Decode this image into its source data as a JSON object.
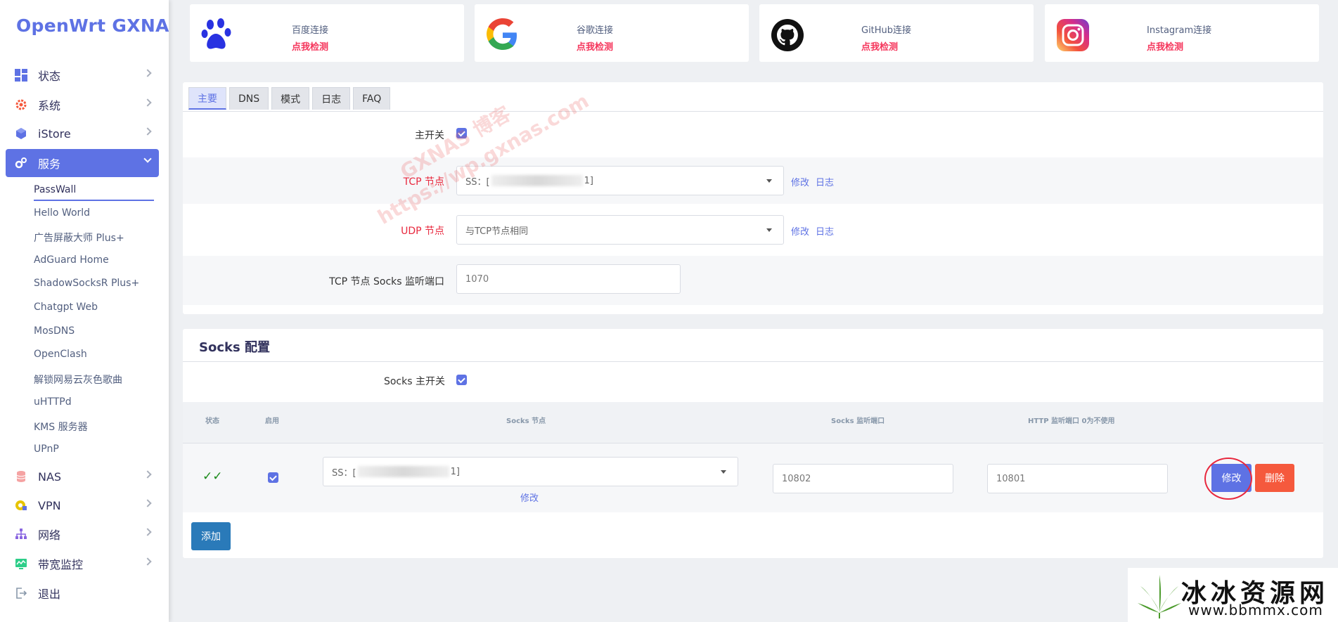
{
  "brand": "OpenWrt GXNAS",
  "sidebar": {
    "items": [
      {
        "label": "状态"
      },
      {
        "label": "系统"
      },
      {
        "label": "iStore"
      },
      {
        "label": "服务"
      },
      {
        "label": "NAS"
      },
      {
        "label": "VPN"
      },
      {
        "label": "网络"
      },
      {
        "label": "带宽监控"
      },
      {
        "label": "退出"
      }
    ],
    "sub_items": [
      "PassWall",
      "Hello World",
      "广告屏蔽大师 Plus+",
      "AdGuard Home",
      "ShadowSocksR Plus+",
      "Chatgpt Web",
      "MosDNS",
      "OpenClash",
      "解锁网易云灰色歌曲",
      "uHTTPd",
      "KMS 服务器",
      "UPnP"
    ]
  },
  "connections": [
    {
      "name": "百度连接",
      "check": "点我检测",
      "icon": "baidu-paw-icon"
    },
    {
      "name": "谷歌连接",
      "check": "点我检测",
      "icon": "google-icon"
    },
    {
      "name": "GitHub连接",
      "check": "点我检测",
      "icon": "github-icon"
    },
    {
      "name": "Instagram连接",
      "check": "点我检测",
      "icon": "instagram-icon"
    }
  ],
  "tabs": [
    "主要",
    "DNS",
    "模式",
    "日志",
    "FAQ"
  ],
  "main": {
    "master_switch_label": "主开关",
    "tcp_node_label": "TCP 节点",
    "tcp_node_prefix": "SS：[",
    "tcp_node_suffix": "1]",
    "udp_node_label": "UDP 节点",
    "udp_node_value": "与TCP节点相同",
    "edit_link": "修改",
    "log_link": "日志",
    "socks_port_label": "TCP 节点 Socks 监听端口",
    "socks_port_value": "1070"
  },
  "socks": {
    "title": "Socks 配置",
    "master_label": "Socks 主开关",
    "headers": {
      "status": "状态",
      "enable": "启用",
      "node": "Socks 节点",
      "port": "Socks 监听端口",
      "http_port": "HTTP 监听端口 0为不使用"
    },
    "row": {
      "status": "✓✓",
      "node_prefix": "SS：[",
      "node_suffix": "1]",
      "edit_link": "修改",
      "port": "10802",
      "http_port": "10801",
      "edit_button": "修改",
      "delete_button": "删除"
    },
    "add_button": "添加"
  },
  "watermark": {
    "line1": "GXNAS 博客",
    "line2": "https://wp.gxnas.com",
    "site_name": "冰冰资源网",
    "site_url": "www.bbmmx.com"
  },
  "colors": {
    "accent": "#5e72e4",
    "danger": "#f5365c",
    "delete": "#f5593d",
    "add": "#2a7ab9"
  }
}
